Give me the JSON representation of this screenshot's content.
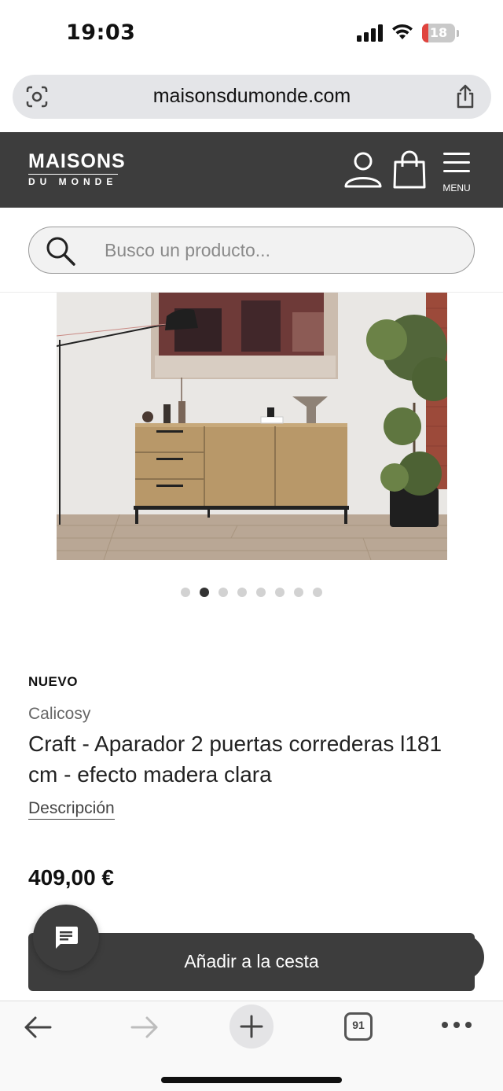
{
  "status_bar": {
    "time": "19:03",
    "battery": "18",
    "battery_level": 0.18
  },
  "browser": {
    "url": "maisonsdumonde.com",
    "tab_count": "91"
  },
  "site_header": {
    "logo_main": "MAISONS",
    "logo_sub": "DU MONDE",
    "menu_label": "MENU"
  },
  "search": {
    "placeholder": "Busco un producto..."
  },
  "gallery": {
    "image_count": 8,
    "active_index": 1
  },
  "product": {
    "badge": "NUEVO",
    "brand": "Calicosy",
    "title": "Craft - Aparador 2 puertas correderas l181 cm - efecto madera clara",
    "description_link": "Descripción",
    "price": "409,00 €"
  },
  "actions": {
    "add_to_cart": "Añadir a la cesta"
  },
  "colors": {
    "header_bg": "#3d3d3d",
    "accent_dark": "#3d3d3d",
    "battery_low": "#e0443e"
  }
}
